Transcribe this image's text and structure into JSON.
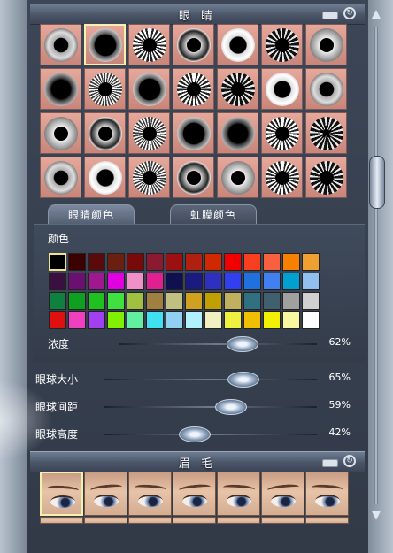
{
  "eyes_section": {
    "title": "眼 睛"
  },
  "eyes_tabs": [
    "眼睛颜色",
    "虹膜颜色"
  ],
  "color_label": "颜色",
  "density": {
    "label": "浓度",
    "value": "62%",
    "level": 0.62
  },
  "sliders": [
    {
      "label": "眼球大小",
      "value": "65%",
      "level": 0.65
    },
    {
      "label": "眼球间距",
      "value": "59%",
      "level": 0.59
    },
    {
      "label": "眼球高度",
      "value": "42%",
      "level": 0.42
    }
  ],
  "eyebrow_section": {
    "title": "眉 毛"
  },
  "icons": {
    "minimize": "minimize-icon",
    "reset": "reset-icon",
    "scroll_up": "scroll-up-icon",
    "scroll_down": "scroll-down-icon"
  },
  "palette_colors": [
    "#000000",
    "#3b0000",
    "#5a0a0a",
    "#6b1f10",
    "#780a0a",
    "#8a1a30",
    "#9b1010",
    "#b02010",
    "#d02800",
    "#f00000",
    "#f84020",
    "#f86040",
    "#f88000",
    "#f0a030",
    "#3a1040",
    "#6a1070",
    "#a01890",
    "#e000e0",
    "#f090c8",
    "#e02090",
    "#101050",
    "#1a1a80",
    "#3030c0",
    "#3040f0",
    "#2070e0",
    "#4080f0",
    "#00a0d0",
    "#90c0f0",
    "#108040",
    "#10a020",
    "#20c020",
    "#40e040",
    "#a0c040",
    "#a08040",
    "#c0c080",
    "#d0a020",
    "#c0a000",
    "#c0b060",
    "#307080",
    "#406070",
    "#a0a0a0",
    "#d0d0d0",
    "#e01010",
    "#f040c0",
    "#a040f0",
    "#80f000",
    "#60f0a0",
    "#40e0f0",
    "#90d0f0",
    "#b0f0ff",
    "#f0f0c0",
    "#f0f040",
    "#f0c000",
    "#f0f000",
    "#f8f8a0",
    "#ffffff"
  ],
  "eye_styles": [
    "e0",
    "e1",
    "e2",
    "e3",
    "e4",
    "e5",
    "e6",
    "e7",
    "e8",
    "e1",
    "e2",
    "e5",
    "e4",
    "e0",
    "e6",
    "e3",
    "e8",
    "e1",
    "e7",
    "e2",
    "e5",
    "e0",
    "e4",
    "e8",
    "e3",
    "e6",
    "e2",
    "e5"
  ]
}
